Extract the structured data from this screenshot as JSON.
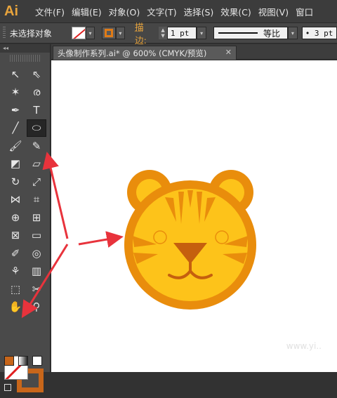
{
  "app": {
    "logo": "Ai"
  },
  "menu": [
    "文件(F)",
    "编辑(E)",
    "对象(O)",
    "文字(T)",
    "选择(S)",
    "效果(C)",
    "视图(V)",
    "窗口"
  ],
  "control": {
    "selection": "未选择对象",
    "stroke_label": "描边:",
    "stroke_weight": "1 pt",
    "profile_label": "等比",
    "brush_value": "• 3 pt"
  },
  "toolbox": {
    "collapse": "◂◂",
    "tools": [
      {
        "name": "selection-tool",
        "glyph": "↖"
      },
      {
        "name": "direct-selection-tool",
        "glyph": "⇖"
      },
      {
        "name": "magic-wand-tool",
        "glyph": "✶"
      },
      {
        "name": "lasso-tool",
        "glyph": "ര"
      },
      {
        "name": "pen-tool",
        "glyph": "✒"
      },
      {
        "name": "type-tool",
        "glyph": "T"
      },
      {
        "name": "line-tool",
        "glyph": "╱"
      },
      {
        "name": "ellipse-tool",
        "glyph": "⬭"
      },
      {
        "name": "paintbrush-tool",
        "glyph": "🖌"
      },
      {
        "name": "pencil-tool",
        "glyph": "✎"
      },
      {
        "name": "blob-brush-tool",
        "glyph": "◩"
      },
      {
        "name": "eraser-tool",
        "glyph": "▱"
      },
      {
        "name": "rotate-tool",
        "glyph": "↻"
      },
      {
        "name": "scale-tool",
        "glyph": "⤢"
      },
      {
        "name": "width-tool",
        "glyph": "⋈"
      },
      {
        "name": "free-transform-tool",
        "glyph": "⌗"
      },
      {
        "name": "shape-builder-tool",
        "glyph": "⊕"
      },
      {
        "name": "perspective-grid-tool",
        "glyph": "⊞"
      },
      {
        "name": "mesh-tool",
        "glyph": "⊠"
      },
      {
        "name": "gradient-tool",
        "glyph": "▭"
      },
      {
        "name": "eyedropper-tool",
        "glyph": "✐"
      },
      {
        "name": "blend-tool",
        "glyph": "◎"
      },
      {
        "name": "symbol-sprayer-tool",
        "glyph": "⚘"
      },
      {
        "name": "column-graph-tool",
        "glyph": "▥"
      },
      {
        "name": "artboard-tool",
        "glyph": "⬚"
      },
      {
        "name": "slice-tool",
        "glyph": "✂"
      },
      {
        "name": "hand-tool",
        "glyph": "✋"
      },
      {
        "name": "zoom-tool",
        "glyph": "⚲"
      }
    ],
    "swap_glyph": "↶"
  },
  "document": {
    "tab_title": "头像制作系列.ai* @ 600% (CMYK/预览)",
    "close": "✕"
  },
  "watermark": "www.yi..",
  "colors": {
    "accent": "#e8a43c",
    "fill_face": "#fdc31a",
    "face_outline": "#e98d0c",
    "stripe": "#e98d0c",
    "nose": "#c55f0e",
    "arrow": "#e8333c",
    "stroke_swatch": "#c8661a"
  }
}
